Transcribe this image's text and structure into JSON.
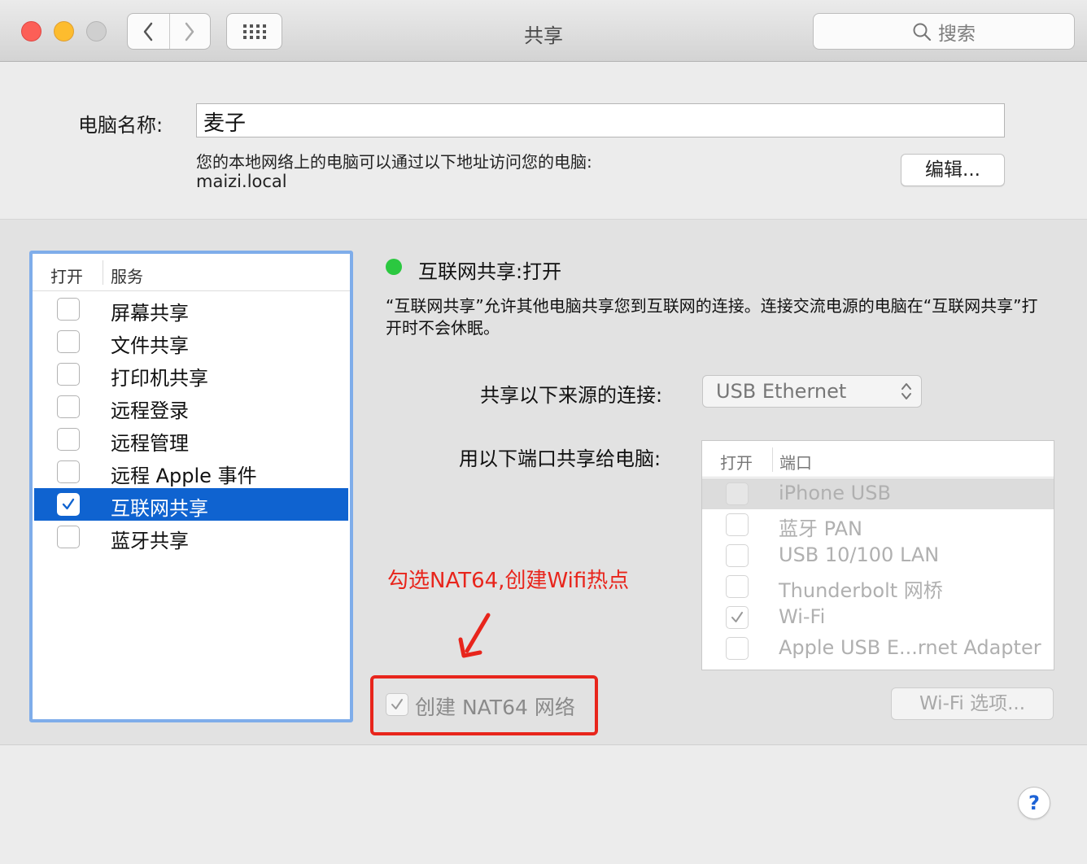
{
  "window": {
    "title": "共享",
    "search_placeholder": "搜索"
  },
  "computer_name": {
    "label": "电脑名称:",
    "value": "麦子",
    "address_description": "您的本地网络上的电脑可以通过以下地址访问您的电脑:",
    "address": "maizi.local",
    "edit_button": "编辑..."
  },
  "services": {
    "header_open": "打开",
    "header_service": "服务",
    "items": [
      {
        "label": "屏幕共享",
        "checked": false
      },
      {
        "label": "文件共享",
        "checked": false
      },
      {
        "label": "打印机共享",
        "checked": false
      },
      {
        "label": "远程登录",
        "checked": false
      },
      {
        "label": "远程管理",
        "checked": false
      },
      {
        "label": "远程 Apple 事件",
        "checked": false
      },
      {
        "label": "互联网共享",
        "checked": true,
        "selected": true
      },
      {
        "label": "蓝牙共享",
        "checked": false
      }
    ]
  },
  "detail": {
    "status": "互联网共享:打开",
    "status_color": "#2bc840",
    "description": "“互联网共享”允许其他电脑共享您到互联网的连接。连接交流电源的电脑在“互联网共享”打开时不会休眠。",
    "source_label": "共享以下来源的连接:",
    "source_value": "USB Ethernet",
    "ports_label": "用以下端口共享给电脑:",
    "ports_header_open": "打开",
    "ports_header_port": "端口",
    "ports": [
      {
        "label": "iPhone USB",
        "checked": false
      },
      {
        "label": "蓝牙 PAN",
        "checked": false
      },
      {
        "label": "USB 10/100 LAN",
        "checked": false
      },
      {
        "label": "Thunderbolt 网桥",
        "checked": false
      },
      {
        "label": "Wi-Fi",
        "checked": true
      },
      {
        "label": "Apple USB E...rnet Adapter",
        "checked": false
      }
    ],
    "nat64_label": "创建 NAT64 网络",
    "nat64_checked": true,
    "wifi_options_button": "Wi-Fi 选项...",
    "annotation": "勾选NAT64,创建Wifi热点",
    "annotation_color": "#e8251c"
  },
  "help_button": "?"
}
